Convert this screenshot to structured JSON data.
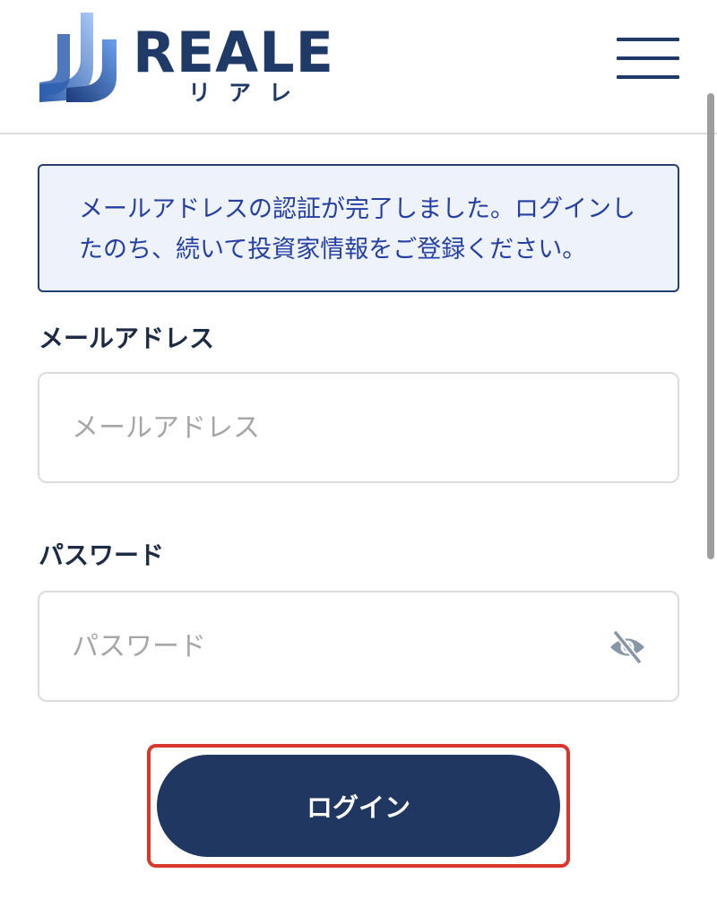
{
  "header": {
    "logo": {
      "wordmark": "REALE",
      "kana": "リアレ"
    },
    "menu_icon": "hamburger-menu-icon"
  },
  "notice": {
    "line1": "メールアドレスの認証が完了しました。ログインし",
    "line2": "たのち、続いて投資家情報をご登録ください。"
  },
  "form": {
    "email": {
      "label": "メールアドレス",
      "value": "",
      "placeholder": "メールアドレス"
    },
    "password": {
      "label": "パスワード",
      "value": "",
      "placeholder": "パスワード",
      "toggle_icon": "eye-slash-icon"
    },
    "login_button": "ログイン"
  },
  "colors": {
    "brand_navy": "#1f3761",
    "notice_bg": "#eef2fb",
    "notice_text": "#2540a0",
    "highlight": "#d9372b"
  }
}
